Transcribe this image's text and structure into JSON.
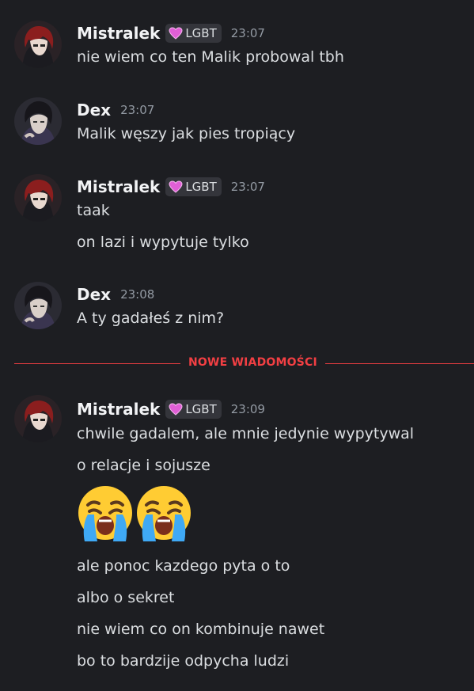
{
  "messages": [
    {
      "user": "Mistralek",
      "tag": "LGBT",
      "time": "23:07",
      "lines": [
        "nie wiem co ten Malik probowal tbh"
      ]
    },
    {
      "user": "Dex",
      "time": "23:07",
      "lines": [
        "Malik węszy jak pies tropiący"
      ]
    },
    {
      "user": "Mistralek",
      "tag": "LGBT",
      "time": "23:07",
      "lines": [
        "taak",
        "on lazi i wypytuje tylko"
      ]
    },
    {
      "user": "Dex",
      "time": "23:08",
      "lines": [
        "A ty gadałeś z nim?"
      ]
    },
    {
      "user": "Mistralek",
      "tag": "LGBT",
      "time": "23:09",
      "lines": [
        "chwile gadalem, ale mnie jedynie wypytywal",
        "o relacje i sojusze",
        "ale ponoc kazdego pyta o to",
        "albo o sekret",
        "nie wiem co on kombinuje nawet",
        "bo to bardzije odpycha ludzi"
      ]
    }
  ],
  "divider_label": "NOWE WIADOMOŚCI",
  "emojis": [
    "sob-emoji",
    "sob-emoji"
  ],
  "colors": {
    "background": "#1d1e22",
    "new_messages": "#f23f43",
    "tag_heart": "#e05fd6",
    "timestamp": "#949ba4"
  }
}
